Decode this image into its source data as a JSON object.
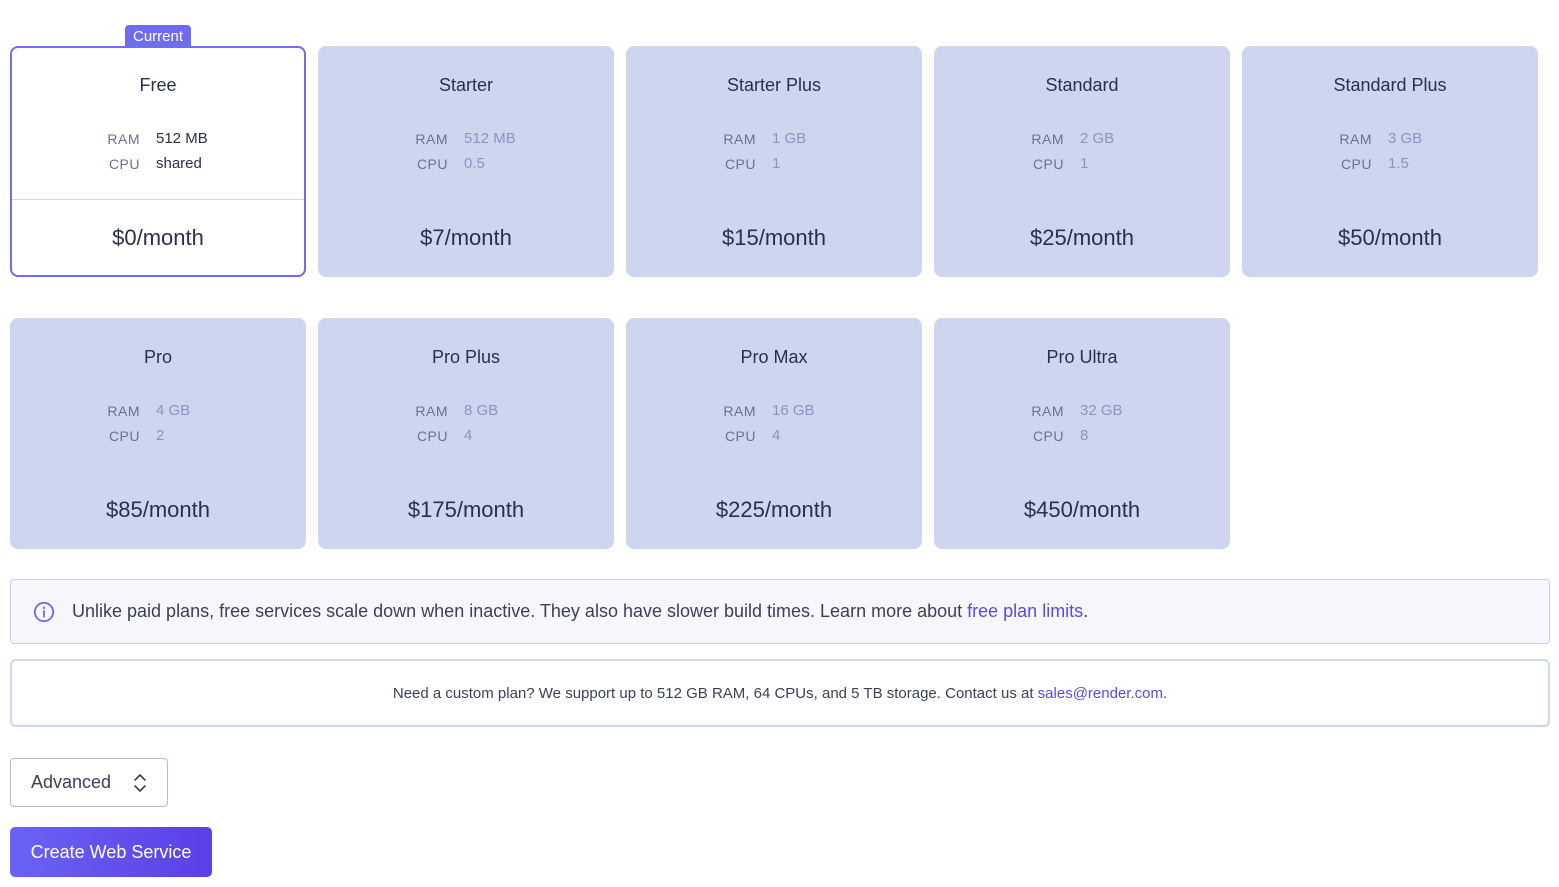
{
  "plans": {
    "ram_label": "RAM",
    "cpu_label": "CPU",
    "current_badge": "Current",
    "items": [
      {
        "name": "Free",
        "ram": "512 MB",
        "cpu": "shared",
        "price": "$0/month"
      },
      {
        "name": "Starter",
        "ram": "512 MB",
        "cpu": "0.5",
        "price": "$7/month"
      },
      {
        "name": "Starter Plus",
        "ram": "1 GB",
        "cpu": "1",
        "price": "$15/month"
      },
      {
        "name": "Standard",
        "ram": "2 GB",
        "cpu": "1",
        "price": "$25/month"
      },
      {
        "name": "Standard Plus",
        "ram": "3 GB",
        "cpu": "1.5",
        "price": "$50/month"
      },
      {
        "name": "Pro",
        "ram": "4 GB",
        "cpu": "2",
        "price": "$85/month"
      },
      {
        "name": "Pro Plus",
        "ram": "8 GB",
        "cpu": "4",
        "price": "$175/month"
      },
      {
        "name": "Pro Max",
        "ram": "16 GB",
        "cpu": "4",
        "price": "$225/month"
      },
      {
        "name": "Pro Ultra",
        "ram": "32 GB",
        "cpu": "8",
        "price": "$450/month"
      }
    ]
  },
  "info": {
    "text": "Unlike paid plans, free services scale down when inactive. They also have slower build times. Learn more about ",
    "link": "free plan limits",
    "suffix": ".",
    "icon": "info-circle-icon"
  },
  "custom": {
    "text": "Need a custom plan? We support up to 512 GB RAM, 64 CPUs, and 5 TB storage. Contact us at ",
    "link": "sales@render.com",
    "suffix": "."
  },
  "advanced": {
    "label": "Advanced",
    "icon": "chevron-up-down-icon"
  },
  "create_button": "Create Web Service",
  "colors": {
    "accent": "#6f6cf0",
    "card_bg": "#cdd6ee",
    "link": "#5a4be0"
  }
}
